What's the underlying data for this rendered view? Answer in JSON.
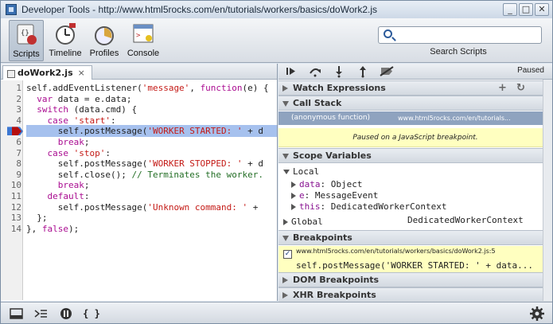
{
  "window": {
    "title": "Developer Tools - http://www.html5rocks.com/en/tutorials/workers/basics/doWork2.js",
    "buttons": {
      "minimize": "_",
      "maximize": "□",
      "close": "✕"
    }
  },
  "toolbar": {
    "items": [
      {
        "label": "Scripts",
        "icon": "scripts-icon",
        "selected": true
      },
      {
        "label": "Timeline",
        "icon": "timeline-icon",
        "selected": false
      },
      {
        "label": "Profiles",
        "icon": "profiles-icon",
        "selected": false
      },
      {
        "label": "Console",
        "icon": "console-icon",
        "selected": false
      }
    ],
    "search_label": "Search Scripts",
    "search_value": ""
  },
  "editor": {
    "tab_label": "doWork2.js",
    "tab_close": "×",
    "breakpoint_line": 5,
    "paused_line": 5,
    "lines": [
      {
        "n": "1",
        "code": "self.addEventListener('message', function(e) {"
      },
      {
        "n": "2",
        "code": "  var data = e.data;"
      },
      {
        "n": "3",
        "code": "  switch (data.cmd) {"
      },
      {
        "n": "4",
        "code": "    case 'start':"
      },
      {
        "n": "5",
        "code": "      self.postMessage('WORKER STARTED: ' + d"
      },
      {
        "n": "6",
        "code": "      break;"
      },
      {
        "n": "7",
        "code": "    case 'stop':"
      },
      {
        "n": "8",
        "code": "      self.postMessage('WORKER STOPPED: ' + d"
      },
      {
        "n": "9",
        "code": "      self.close(); // Terminates the worker."
      },
      {
        "n": "10",
        "code": "      break;"
      },
      {
        "n": "11",
        "code": "    default:"
      },
      {
        "n": "12",
        "code": "      self.postMessage('Unknown command: ' +"
      },
      {
        "n": "13",
        "code": "  };"
      },
      {
        "n": "14",
        "code": "}, false);"
      }
    ]
  },
  "debugger": {
    "status": "Paused",
    "watch_label": "Watch Expressions",
    "callstack_label": "Call Stack",
    "callstack": {
      "fn": "(anonymous function)",
      "url": "www.html5rocks.com/en/tutorials..."
    },
    "paused_msg": "Paused on a JavaScript breakpoint.",
    "scope_label": "Scope Variables",
    "scope": {
      "local_label": "Local",
      "vars": [
        {
          "name": "data",
          "value": "Object"
        },
        {
          "name": "e",
          "value": "MessageEvent"
        },
        {
          "name": "this",
          "value": "DedicatedWorkerContext"
        }
      ],
      "global_label": "Global",
      "global_value": "DedicatedWorkerContext"
    },
    "breakpoints_label": "Breakpoints",
    "breakpoint": {
      "url": "www.html5rocks.com/en/tutorials/workers/basics/doWork2.js:5",
      "code": "self.postMessage('WORKER STARTED: ' + data..."
    },
    "dom_bp_label": "DOM Breakpoints",
    "xhr_bp_label": "XHR Breakpoints"
  },
  "colors": {
    "accent": "#3c78d2",
    "selection": "#a6c1ee",
    "paused_bg": "#ffffc0",
    "callstack_sel": "#8fa3bf"
  }
}
